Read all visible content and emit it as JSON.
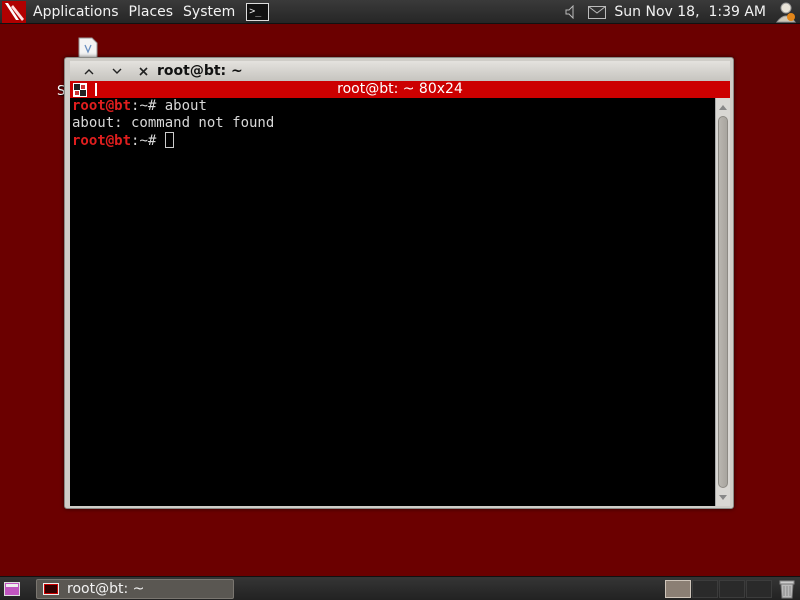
{
  "top_panel": {
    "menu": [
      "Applications",
      "Places",
      "System"
    ],
    "launcher_glyph": ">_",
    "clock": "Sun Nov 18,  1:39 AM",
    "icons": [
      "backtrack-logo-icon",
      "terminal-icon",
      "speaker-icon",
      "mail-icon",
      "user-icon"
    ]
  },
  "desktop": {
    "icon_label": "S"
  },
  "terminal": {
    "window_title": "root@bt: ~",
    "tab_title": "root@bt: ~ 80x24",
    "lines": [
      {
        "prompt_user": "root@bt",
        "prompt_rest": ":~# ",
        "command": "about"
      },
      {
        "output": "about: command not found"
      },
      {
        "prompt_user": "root@bt",
        "prompt_rest": ":~# ",
        "command": ""
      }
    ]
  },
  "taskbar": {
    "task_label": "root@bt: ~",
    "workspaces": 4,
    "active_workspace": 1
  },
  "colors": {
    "desktop_bg": "#6b0000",
    "tab_bar": "#cc0000",
    "prompt": "#e01e1e"
  }
}
